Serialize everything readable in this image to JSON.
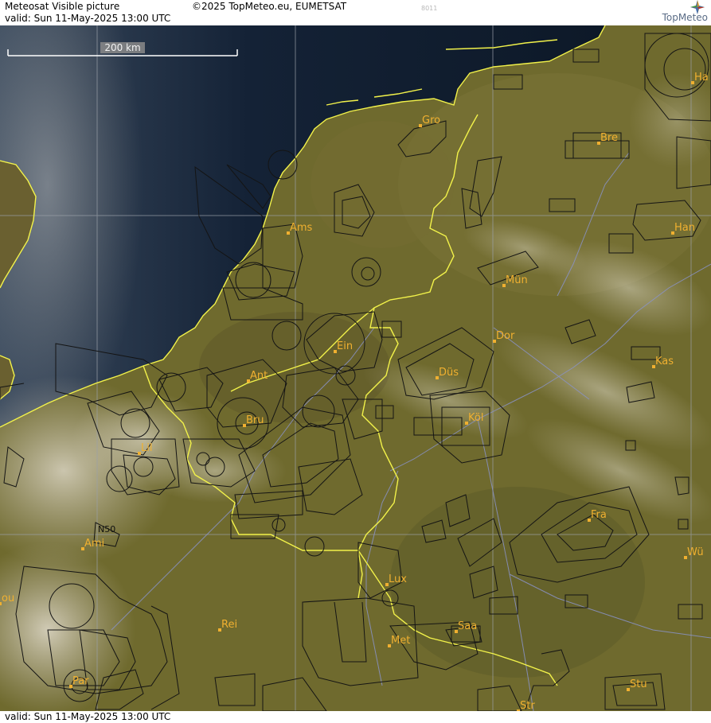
{
  "header": {
    "title": "Meteosat Visible picture",
    "copyright": "©2025 TopMeteo.eu, EUMETSAT",
    "code": "8011",
    "valid": "valid:  Sun  11-May-2025  13:00 UTC",
    "logo_text": "TopMeteo"
  },
  "scale": {
    "label": "200 km"
  },
  "gridlabel": "N50",
  "cities": [
    {
      "name": "Gro"
    },
    {
      "name": "Bre"
    },
    {
      "name": "Ha"
    },
    {
      "name": "Ams"
    },
    {
      "name": "Han"
    },
    {
      "name": "Mün"
    },
    {
      "name": "Ein"
    },
    {
      "name": "Dor"
    },
    {
      "name": "Ant"
    },
    {
      "name": "Düs"
    },
    {
      "name": "Kas"
    },
    {
      "name": "Bru"
    },
    {
      "name": "Köl"
    },
    {
      "name": "Lil"
    },
    {
      "name": "Fra"
    },
    {
      "name": "Ami"
    },
    {
      "name": "Wü"
    },
    {
      "name": "Lux"
    },
    {
      "name": "ou"
    },
    {
      "name": "Rei"
    },
    {
      "name": "Saa"
    },
    {
      "name": "Met"
    },
    {
      "name": "Par"
    },
    {
      "name": "Stu"
    },
    {
      "name": "Str"
    }
  ],
  "colors": {
    "sea": "#0e1a2a",
    "land": "#6f6a2e",
    "border": "#f2f24a",
    "airspace": "#141414",
    "river": "#8a93c8",
    "grid": "#9aa0a8",
    "label": "#f0b030"
  },
  "footer": {
    "valid": "valid:  Sun  11-May-2025  13:00 UTC"
  }
}
